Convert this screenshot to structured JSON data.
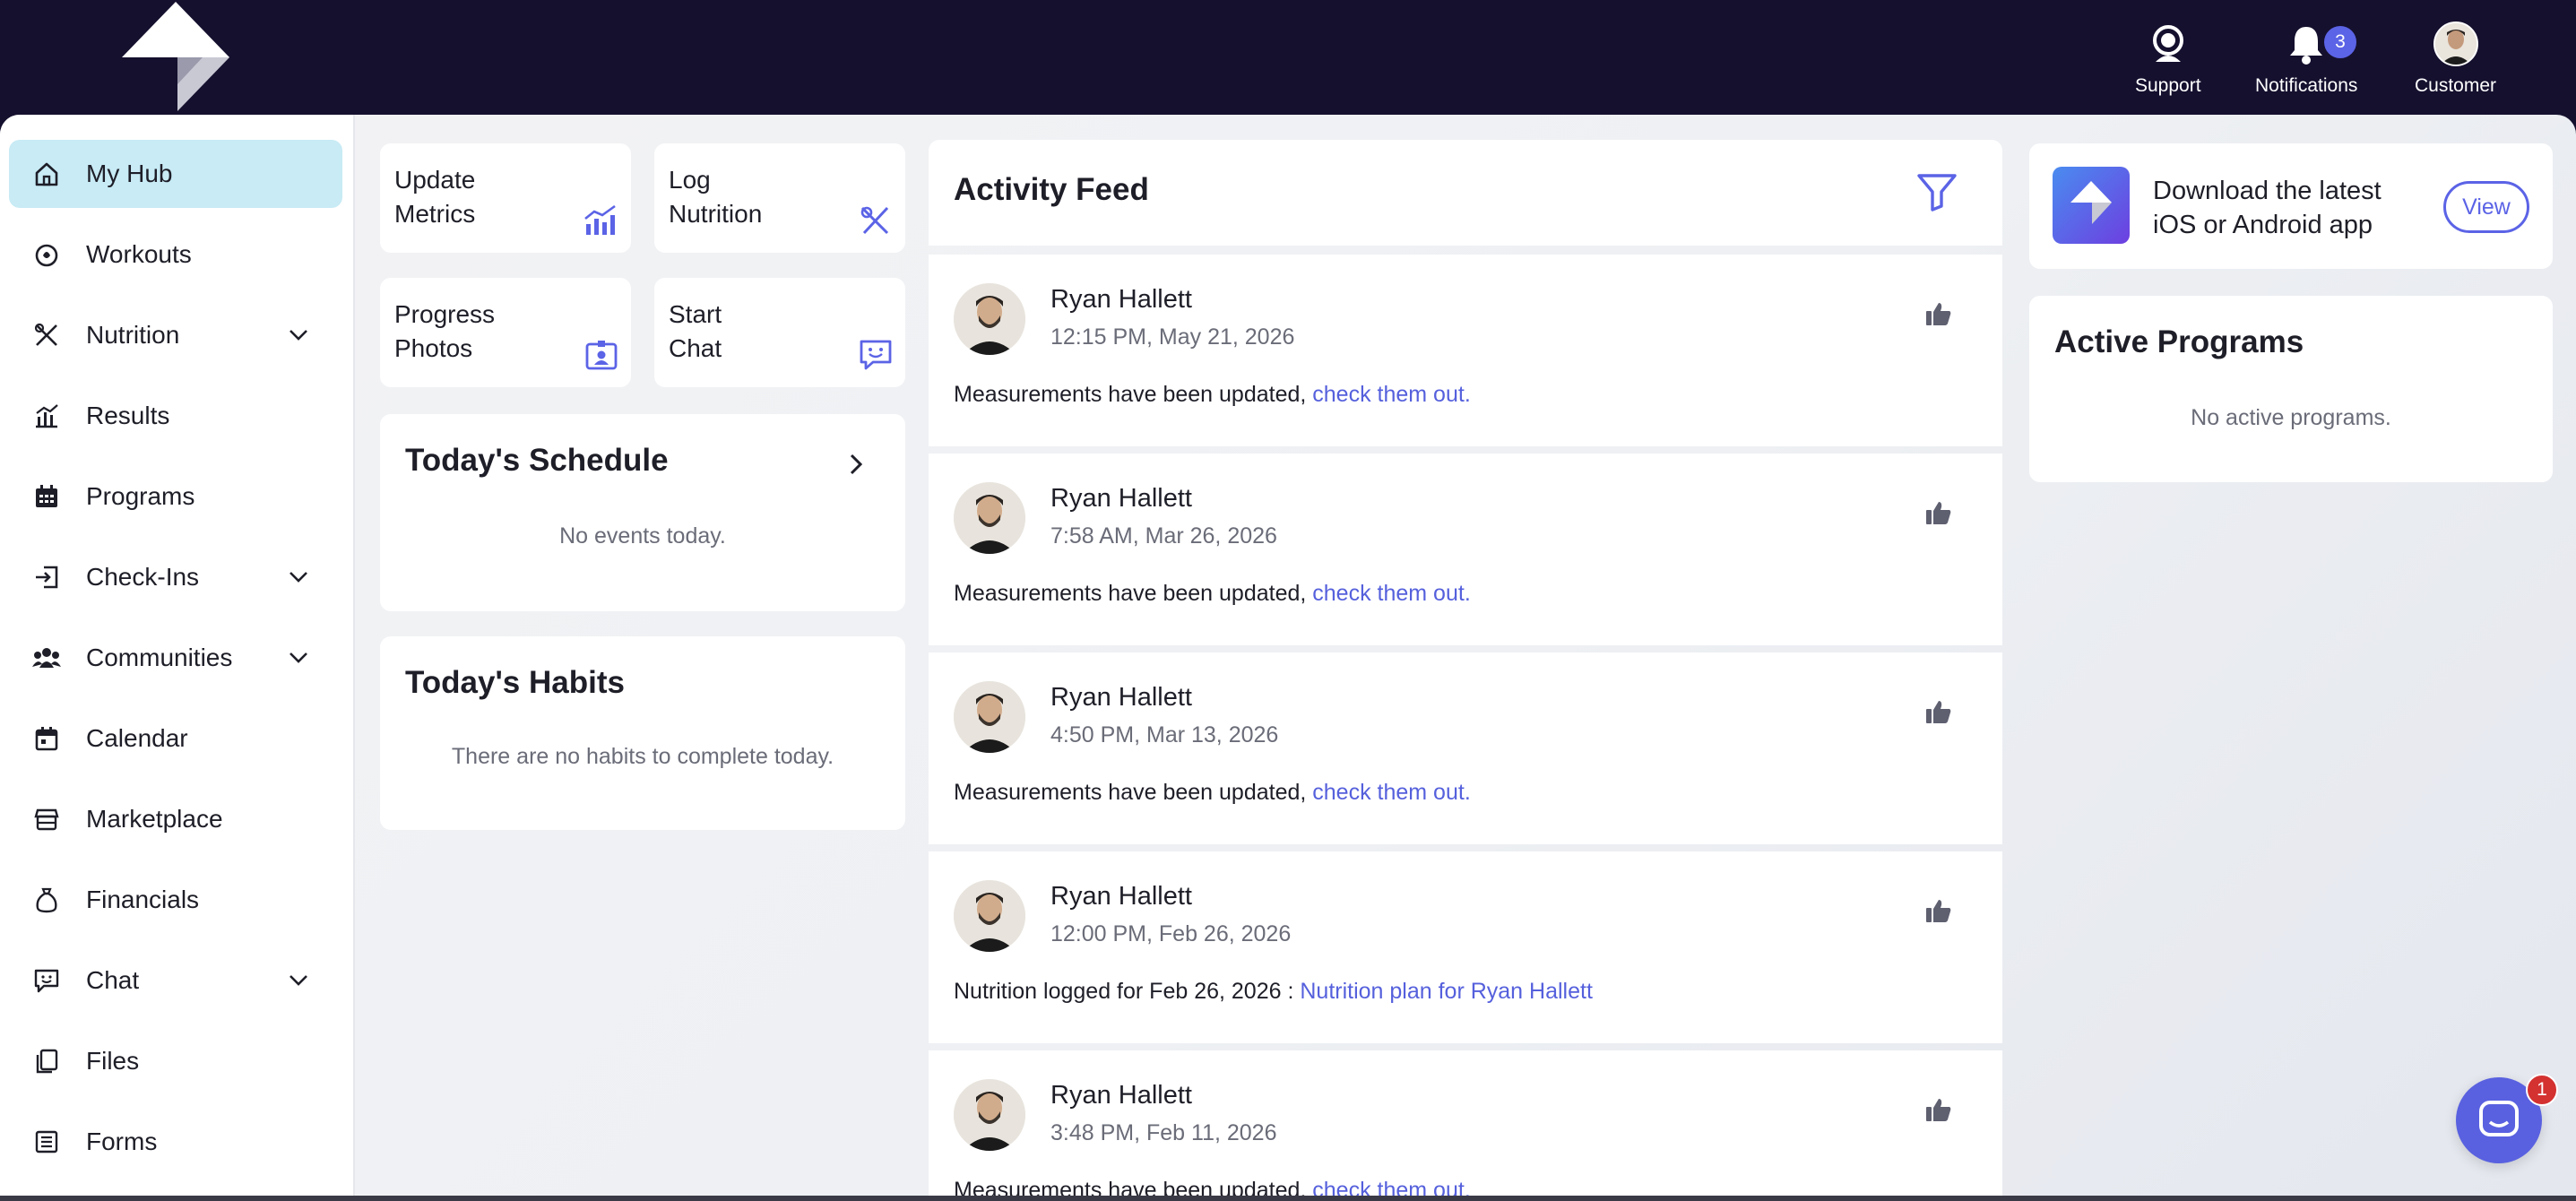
{
  "header": {
    "support_label": "Support",
    "notifications_label": "Notifications",
    "notifications_count": "3",
    "customer_label": "Customer"
  },
  "sidebar": {
    "items": [
      {
        "label": "My Hub",
        "icon": "home-icon",
        "active": true
      },
      {
        "label": "Workouts",
        "icon": "workout-icon"
      },
      {
        "label": "Nutrition",
        "icon": "utensils-icon",
        "expandable": true
      },
      {
        "label": "Results",
        "icon": "chart-icon"
      },
      {
        "label": "Programs",
        "icon": "calendar-grid-icon"
      },
      {
        "label": "Check-Ins",
        "icon": "sign-in-icon",
        "expandable": true
      },
      {
        "label": "Communities",
        "icon": "users-icon",
        "expandable": true
      },
      {
        "label": "Calendar",
        "icon": "calendar-icon"
      },
      {
        "label": "Marketplace",
        "icon": "store-icon"
      },
      {
        "label": "Financials",
        "icon": "money-bag-icon"
      },
      {
        "label": "Chat",
        "icon": "chat-icon",
        "expandable": true
      },
      {
        "label": "Files",
        "icon": "files-icon"
      },
      {
        "label": "Forms",
        "icon": "form-icon"
      }
    ]
  },
  "quick_actions": {
    "update_metrics": {
      "line1": "Update",
      "line2": "Metrics",
      "icon": "chart-up-icon"
    },
    "log_nutrition": {
      "line1": "Log",
      "line2": "Nutrition",
      "icon": "utensils-icon"
    },
    "progress_photos": {
      "line1": "Progress",
      "line2": "Photos",
      "icon": "photo-id-icon"
    },
    "start_chat": {
      "line1": "Start",
      "line2": "Chat",
      "icon": "chat-smile-icon"
    }
  },
  "schedule": {
    "title": "Today's Schedule",
    "empty": "No events today."
  },
  "habits": {
    "title": "Today's Habits",
    "empty": "There are no habits to complete today."
  },
  "feed": {
    "title": "Activity Feed",
    "items": [
      {
        "name": "Ryan Hallett",
        "date": "12:15 PM, May 21, 2026",
        "text": "Measurements have been updated, ",
        "link": "check them out."
      },
      {
        "name": "Ryan Hallett",
        "date": "7:58 AM, Mar 26, 2026",
        "text": "Measurements have been updated, ",
        "link": "check them out."
      },
      {
        "name": "Ryan Hallett",
        "date": "4:50 PM, Mar 13, 2026",
        "text": "Measurements have been updated, ",
        "link": "check them out."
      },
      {
        "name": "Ryan Hallett",
        "date": "12:00 PM, Feb 26, 2026",
        "text": "Nutrition logged for Feb 26, 2026 : ",
        "link": "Nutrition plan for Ryan Hallett"
      },
      {
        "name": "Ryan Hallett",
        "date": "3:48 PM, Feb 11, 2026",
        "text": "Measurements have been updated, ",
        "link": "check them out."
      }
    ]
  },
  "app_promo": {
    "line1": "Download the latest",
    "line2": "iOS or Android app",
    "button": "View"
  },
  "active_programs": {
    "title": "Active Programs",
    "empty": "No active programs."
  },
  "chat_widget": {
    "badge": "1"
  },
  "colors": {
    "brand_dark": "#15102e",
    "accent": "#5b63e6",
    "active_nav": "#c8ebf5",
    "link": "#5560dc"
  }
}
